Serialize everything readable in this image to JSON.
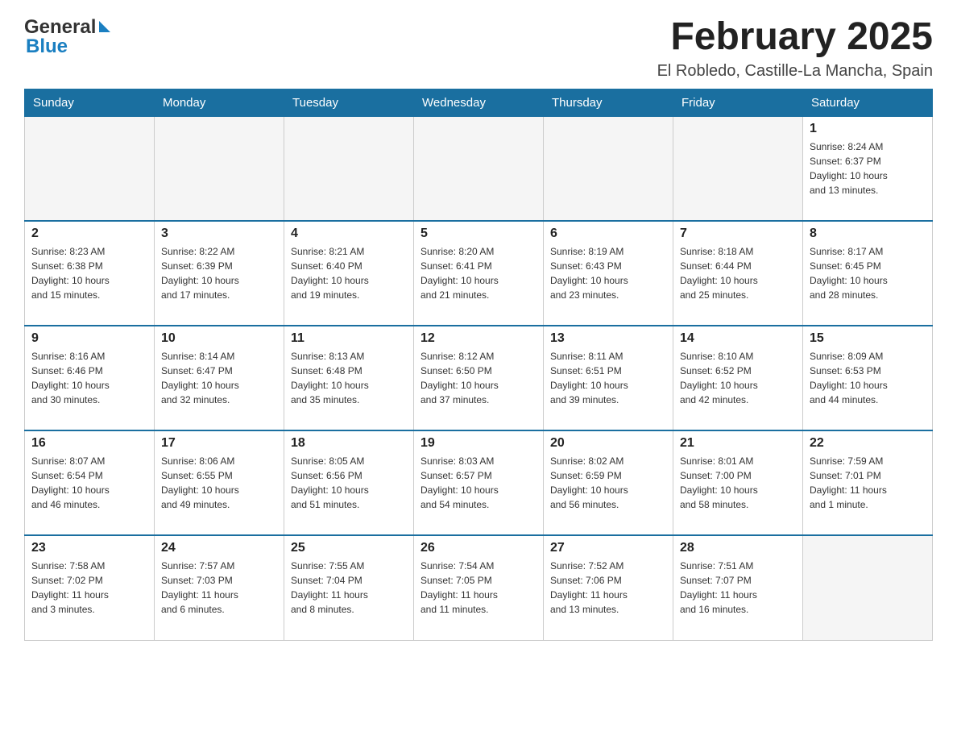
{
  "header": {
    "logo_general": "General",
    "logo_blue": "Blue",
    "month_title": "February 2025",
    "location": "El Robledo, Castille-La Mancha, Spain"
  },
  "days_of_week": [
    "Sunday",
    "Monday",
    "Tuesday",
    "Wednesday",
    "Thursday",
    "Friday",
    "Saturday"
  ],
  "weeks": [
    {
      "days": [
        {
          "number": "",
          "info": ""
        },
        {
          "number": "",
          "info": ""
        },
        {
          "number": "",
          "info": ""
        },
        {
          "number": "",
          "info": ""
        },
        {
          "number": "",
          "info": ""
        },
        {
          "number": "",
          "info": ""
        },
        {
          "number": "1",
          "info": "Sunrise: 8:24 AM\nSunset: 6:37 PM\nDaylight: 10 hours\nand 13 minutes."
        }
      ]
    },
    {
      "days": [
        {
          "number": "2",
          "info": "Sunrise: 8:23 AM\nSunset: 6:38 PM\nDaylight: 10 hours\nand 15 minutes."
        },
        {
          "number": "3",
          "info": "Sunrise: 8:22 AM\nSunset: 6:39 PM\nDaylight: 10 hours\nand 17 minutes."
        },
        {
          "number": "4",
          "info": "Sunrise: 8:21 AM\nSunset: 6:40 PM\nDaylight: 10 hours\nand 19 minutes."
        },
        {
          "number": "5",
          "info": "Sunrise: 8:20 AM\nSunset: 6:41 PM\nDaylight: 10 hours\nand 21 minutes."
        },
        {
          "number": "6",
          "info": "Sunrise: 8:19 AM\nSunset: 6:43 PM\nDaylight: 10 hours\nand 23 minutes."
        },
        {
          "number": "7",
          "info": "Sunrise: 8:18 AM\nSunset: 6:44 PM\nDaylight: 10 hours\nand 25 minutes."
        },
        {
          "number": "8",
          "info": "Sunrise: 8:17 AM\nSunset: 6:45 PM\nDaylight: 10 hours\nand 28 minutes."
        }
      ]
    },
    {
      "days": [
        {
          "number": "9",
          "info": "Sunrise: 8:16 AM\nSunset: 6:46 PM\nDaylight: 10 hours\nand 30 minutes."
        },
        {
          "number": "10",
          "info": "Sunrise: 8:14 AM\nSunset: 6:47 PM\nDaylight: 10 hours\nand 32 minutes."
        },
        {
          "number": "11",
          "info": "Sunrise: 8:13 AM\nSunset: 6:48 PM\nDaylight: 10 hours\nand 35 minutes."
        },
        {
          "number": "12",
          "info": "Sunrise: 8:12 AM\nSunset: 6:50 PM\nDaylight: 10 hours\nand 37 minutes."
        },
        {
          "number": "13",
          "info": "Sunrise: 8:11 AM\nSunset: 6:51 PM\nDaylight: 10 hours\nand 39 minutes."
        },
        {
          "number": "14",
          "info": "Sunrise: 8:10 AM\nSunset: 6:52 PM\nDaylight: 10 hours\nand 42 minutes."
        },
        {
          "number": "15",
          "info": "Sunrise: 8:09 AM\nSunset: 6:53 PM\nDaylight: 10 hours\nand 44 minutes."
        }
      ]
    },
    {
      "days": [
        {
          "number": "16",
          "info": "Sunrise: 8:07 AM\nSunset: 6:54 PM\nDaylight: 10 hours\nand 46 minutes."
        },
        {
          "number": "17",
          "info": "Sunrise: 8:06 AM\nSunset: 6:55 PM\nDaylight: 10 hours\nand 49 minutes."
        },
        {
          "number": "18",
          "info": "Sunrise: 8:05 AM\nSunset: 6:56 PM\nDaylight: 10 hours\nand 51 minutes."
        },
        {
          "number": "19",
          "info": "Sunrise: 8:03 AM\nSunset: 6:57 PM\nDaylight: 10 hours\nand 54 minutes."
        },
        {
          "number": "20",
          "info": "Sunrise: 8:02 AM\nSunset: 6:59 PM\nDaylight: 10 hours\nand 56 minutes."
        },
        {
          "number": "21",
          "info": "Sunrise: 8:01 AM\nSunset: 7:00 PM\nDaylight: 10 hours\nand 58 minutes."
        },
        {
          "number": "22",
          "info": "Sunrise: 7:59 AM\nSunset: 7:01 PM\nDaylight: 11 hours\nand 1 minute."
        }
      ]
    },
    {
      "days": [
        {
          "number": "23",
          "info": "Sunrise: 7:58 AM\nSunset: 7:02 PM\nDaylight: 11 hours\nand 3 minutes."
        },
        {
          "number": "24",
          "info": "Sunrise: 7:57 AM\nSunset: 7:03 PM\nDaylight: 11 hours\nand 6 minutes."
        },
        {
          "number": "25",
          "info": "Sunrise: 7:55 AM\nSunset: 7:04 PM\nDaylight: 11 hours\nand 8 minutes."
        },
        {
          "number": "26",
          "info": "Sunrise: 7:54 AM\nSunset: 7:05 PM\nDaylight: 11 hours\nand 11 minutes."
        },
        {
          "number": "27",
          "info": "Sunrise: 7:52 AM\nSunset: 7:06 PM\nDaylight: 11 hours\nand 13 minutes."
        },
        {
          "number": "28",
          "info": "Sunrise: 7:51 AM\nSunset: 7:07 PM\nDaylight: 11 hours\nand 16 minutes."
        },
        {
          "number": "",
          "info": ""
        }
      ]
    }
  ]
}
